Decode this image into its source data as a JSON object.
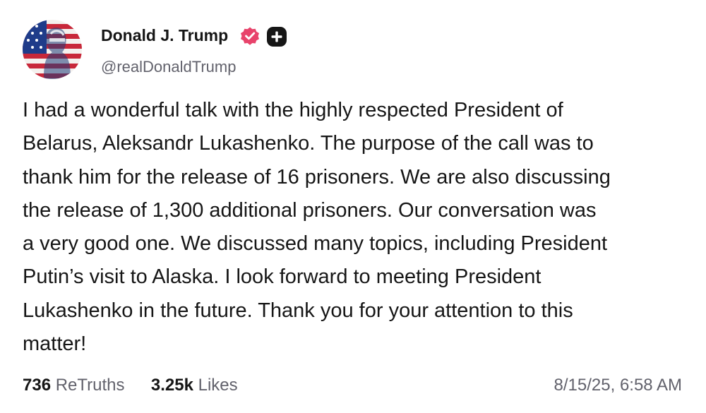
{
  "author": {
    "display_name": "Donald J. Trump",
    "handle": "@realDonaldTrump",
    "avatar_icon": "flag-portrait-avatar",
    "verified_icon": "verified-badge-icon",
    "plus_icon": "plus-badge-icon"
  },
  "post": {
    "lines": [
      "I had a wonderful talk with the highly respected President of",
      "Belarus, Aleksandr Lukashenko. The purpose of the call was to",
      "thank him for the release of 16 prisoners. We are also discussing",
      "the release of 1,300 additional prisoners. Our conversation was",
      "a very good one. We discussed many topics, including President",
      "Putin’s visit to Alaska. I look forward to meeting President",
      "Lukashenko in the future. Thank you for your attention to this",
      "matter!"
    ]
  },
  "stats": {
    "retruths_count": "736",
    "retruths_label": "ReTruths",
    "likes_count": "3.25k",
    "likes_label": "Likes"
  },
  "timestamp": "8/15/25, 6:58 AM",
  "colors": {
    "text": "#161616",
    "muted": "#62626c",
    "verified": "#e8436b",
    "badge": "#161616"
  }
}
